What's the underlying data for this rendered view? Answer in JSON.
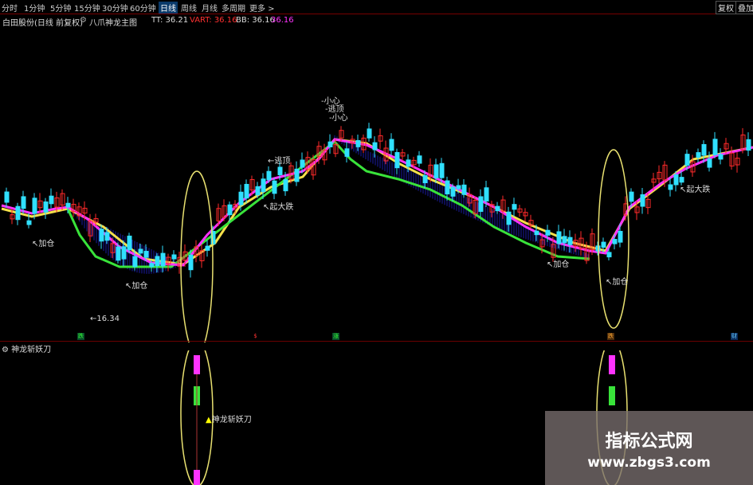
{
  "tabs": [
    {
      "label": "分时"
    },
    {
      "label": "1分钟"
    },
    {
      "label": "5分钟"
    },
    {
      "label": "15分钟"
    },
    {
      "label": "30分钟"
    },
    {
      "label": "60分钟"
    },
    {
      "label": "日线",
      "active": true
    },
    {
      "label": "周线"
    },
    {
      "label": "月线"
    },
    {
      "label": "多周期"
    },
    {
      "label": "更多 >"
    }
  ],
  "right_buttons": [
    {
      "label": "复权"
    },
    {
      "label": "叠加"
    }
  ],
  "header": {
    "stock": "白田股份(日线 前复权)",
    "indicator": "八爪神龙主图",
    "tt_label": "TT: 36.21",
    "vart_label": "VART: 36.16",
    "bb_label": "BB: 36.16",
    "extra_value": "36.16"
  },
  "annotations": {
    "add1": "加仓",
    "add2": "加仓",
    "add3": "加仓",
    "add4": "加仓",
    "low_price": "16.34",
    "rise1": "起大跌",
    "rise2": "起大跌",
    "escape": "逃顶",
    "top1": "小心",
    "top2": "逃顶",
    "top3": "小心"
  },
  "markers": [
    "跌",
    "$",
    "涨",
    "跌",
    "财"
  ],
  "indicator_panel": {
    "title": "神龙斩妖刀",
    "label": "神龙斩妖刀"
  },
  "watermark": {
    "title": "指标公式网",
    "url": "www.zbgs3.com"
  },
  "colors": {
    "up": "#ff2a2a",
    "down": "#30e0ff",
    "ma_yellow": "#f5e04a",
    "ma_magenta": "#ff33ff",
    "ma_green": "#39e33a",
    "fill_blue": "#1a1aa0"
  }
}
